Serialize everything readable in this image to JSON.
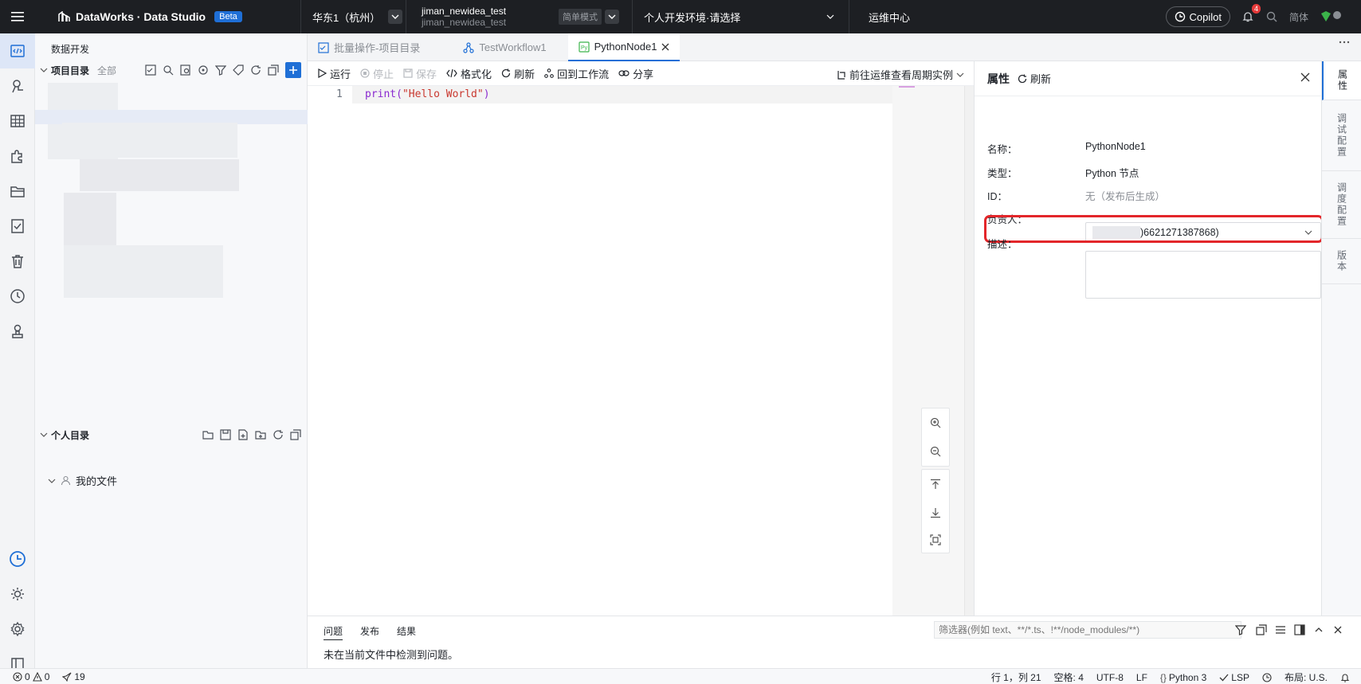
{
  "topbar": {
    "brand": "DataWorks · Data Studio",
    "beta": "Beta",
    "region": "华东1（杭州）",
    "workspace_name": "jiman_newidea_test",
    "workspace_id": "jiman_newidea_test",
    "mode": "简单模式",
    "env": "个人开发环境·请选择",
    "ops_center": "运维中心",
    "copilot": "Copilot",
    "notification_count": "4",
    "lang": "简体"
  },
  "explorer": {
    "title": "数据开发",
    "project_dir": "项目目录",
    "project_filter": "全部",
    "personal_dir": "个人目录",
    "my_files": "我的文件"
  },
  "tabs": [
    {
      "label": "批量操作-项目目录"
    },
    {
      "label": "TestWorkflow1"
    },
    {
      "label": "PythonNode1"
    }
  ],
  "toolbar": {
    "run": "运行",
    "stop": "停止",
    "save": "保存",
    "format": "格式化",
    "refresh": "刷新",
    "back_to_workflow": "回到工作流",
    "share": "分享",
    "goto_ops": "前往运维查看周期实例"
  },
  "editor": {
    "line_number": "1",
    "code_func": "print",
    "code_open": "(",
    "code_string": "\"Hello World\"",
    "code_close": ")"
  },
  "properties": {
    "title": "属性",
    "refresh": "刷新",
    "name_label": "名称：",
    "name_value": "PythonNode1",
    "type_label": "类型：",
    "type_value": "Python 节点",
    "id_label": "ID：",
    "id_value": "无（发布后生成）",
    "owner_label": "负责人：",
    "owner_value": ")6621271387868)",
    "desc_label": "描述："
  },
  "right_tabs": [
    {
      "label": "属性"
    },
    {
      "label": "调试配置"
    },
    {
      "label": "调度配置"
    },
    {
      "label": "版本"
    }
  ],
  "bottom_panel": {
    "tabs": [
      "问题",
      "发布",
      "结果"
    ],
    "filter_placeholder": "筛选器(例如 text、**/*.ts、!**/node_modules/**)",
    "message": "未在当前文件中检测到问题。"
  },
  "statusbar": {
    "errors": "0",
    "warnings": "0",
    "deploy_count": "19",
    "cursor": "行 1，列 21",
    "indent": "空格: 4",
    "encoding": "UTF-8",
    "eol": "LF",
    "language": "Python 3",
    "lsp": "LSP",
    "layout": "布局: U.S."
  },
  "colors": {
    "accent": "#1f6fd6",
    "topbar_bg": "#1d1f23",
    "highlight_border": "#e3262a"
  }
}
